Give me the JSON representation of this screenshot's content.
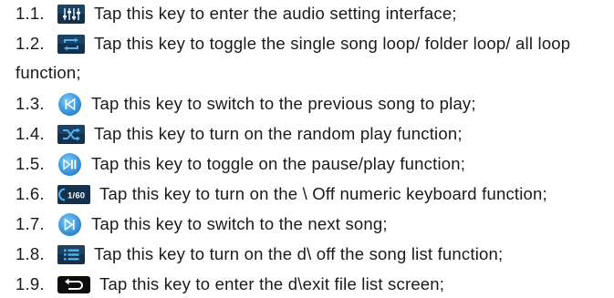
{
  "items": [
    {
      "num": "1.1.",
      "icon": "equalizer-icon",
      "text": "Tap this key to enter the audio setting interface;"
    },
    {
      "num": "1.2.",
      "icon": "repeat-icon",
      "text": "Tap this key to toggle the single song loop/ folder loop/ all loop"
    },
    {
      "num": "",
      "icon": "",
      "text": "function;"
    },
    {
      "num": "1.3.",
      "icon": "previous-icon",
      "text": "Tap this key to switch to the previous song to play;"
    },
    {
      "num": "1.4.",
      "icon": "shuffle-icon",
      "text": "Tap this key to turn on the random play function;"
    },
    {
      "num": "1.5.",
      "icon": "play-pause-icon",
      "text": "Tap this key to toggle on the pause/play function;"
    },
    {
      "num": "1.6.",
      "icon": "numeric-keypad-icon",
      "icon_text": "1/60",
      "text": "Tap this key to turn on the \\ Off numeric keyboard function;"
    },
    {
      "num": "1.7.",
      "icon": "next-icon",
      "text": "Tap this key to switch to the next song;"
    },
    {
      "num": "1.8.",
      "icon": "list-icon",
      "text": "Tap this key to turn on the d\\ off the song list function;"
    },
    {
      "num": "1.9.",
      "icon": "back-icon",
      "text": "Tap this key to enter the d\\exit file list screen;"
    }
  ],
  "colors": {
    "icon_dark": "#14304a",
    "icon_accent": "#3fa7e6",
    "icon_round": "#2f8fd6",
    "back_bg": "#0c0c0c",
    "text": "#1a1a1a"
  }
}
